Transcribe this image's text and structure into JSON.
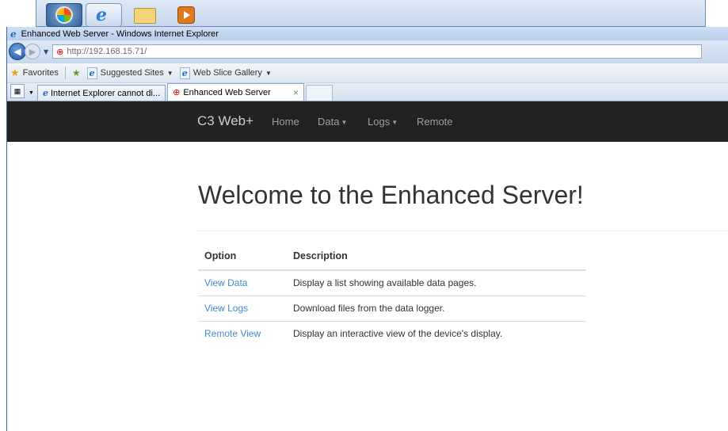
{
  "window": {
    "title": "Enhanced Web Server - Windows Internet Explorer",
    "address": "http://192.168.15.71/"
  },
  "favorites": {
    "label": "Favorites",
    "suggested_sites": "Suggested Sites",
    "web_slice_gallery": "Web Slice Gallery"
  },
  "tabs": [
    {
      "label": "Internet Explorer cannot di..."
    },
    {
      "label": "Enhanced Web Server",
      "close": "×"
    }
  ],
  "site_nav": {
    "brand": "C3 Web+",
    "items": [
      "Home",
      "Data",
      "Logs",
      "Remote"
    ]
  },
  "page": {
    "heading": "Welcome to the Enhanced Server!",
    "table": {
      "headers": [
        "Option",
        "Description"
      ],
      "rows": [
        {
          "option": "View Data",
          "description": "Display a list showing available data pages."
        },
        {
          "option": "View Logs",
          "description": "Download files from the data logger."
        },
        {
          "option": "Remote View",
          "description": "Display an interactive view of the device's display."
        }
      ]
    }
  },
  "colors": {
    "navbar_bg": "#222222",
    "link": "#428bca",
    "nav_text": "#9d9d9d"
  }
}
